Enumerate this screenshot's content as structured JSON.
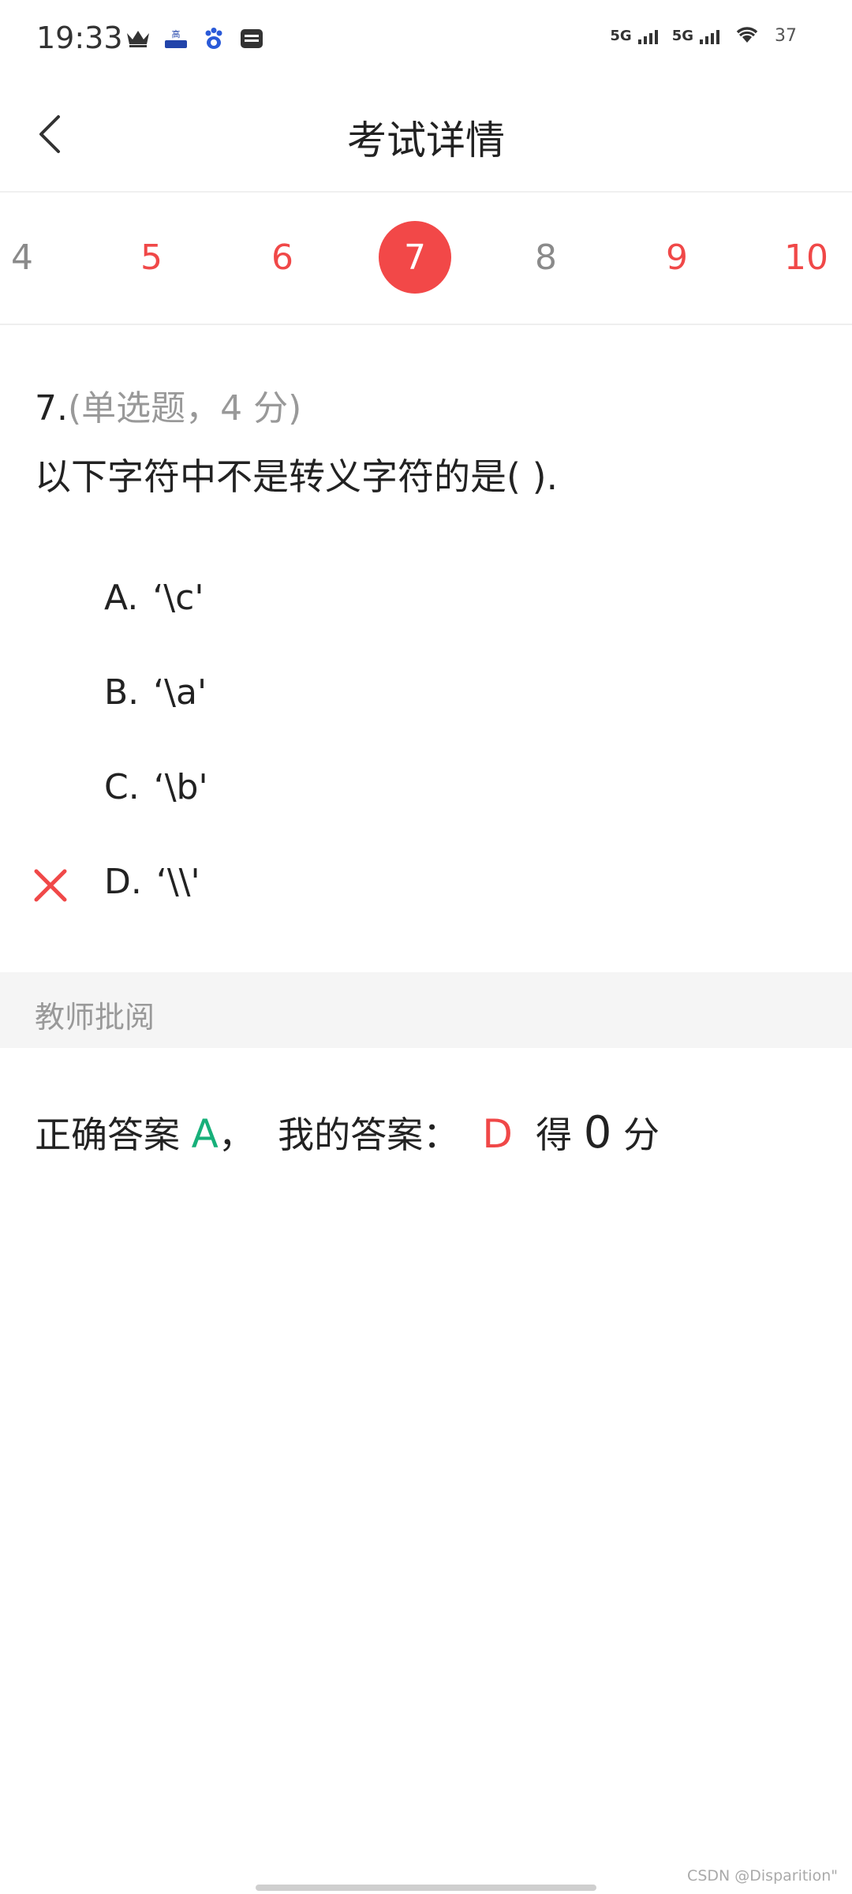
{
  "status_bar": {
    "time": "19:33",
    "left_icons": [
      "crown-icon",
      "gaotu-app-icon",
      "baidu-paw-icon",
      "message-box-icon"
    ],
    "sim1": "5G",
    "sim2": "5G",
    "battery": "37"
  },
  "header": {
    "title": "考试详情",
    "back_icon": "chevron-left-icon"
  },
  "question_nav": {
    "items": [
      {
        "label": "4",
        "state": "right"
      },
      {
        "label": "5",
        "state": "wrong"
      },
      {
        "label": "6",
        "state": "wrong"
      },
      {
        "label": "7",
        "state": "active"
      },
      {
        "label": "8",
        "state": "right"
      },
      {
        "label": "9",
        "state": "wrong"
      },
      {
        "label": "10",
        "state": "wrong"
      }
    ]
  },
  "question": {
    "number": "7.",
    "type_info": "(单选题，4 分)",
    "stem": "以下字符中不是转义字符的是( ).",
    "options": [
      {
        "letter": "A.",
        "text": "‘\\c'",
        "mark": ""
      },
      {
        "letter": "B.",
        "text": "‘\\a'",
        "mark": ""
      },
      {
        "letter": "C.",
        "text": "‘\\b'",
        "mark": ""
      },
      {
        "letter": "D.",
        "text": "‘\\\\'",
        "mark": "wrong-x-icon"
      }
    ]
  },
  "review": {
    "label": "教师批阅",
    "correct_prefix": "正确答案 ",
    "correct_answer": "A",
    "separator": "，  我的答案：  ",
    "my_answer": "D",
    "score_prefix": "  得 ",
    "score": "0",
    "score_suffix": " 分"
  },
  "colors": {
    "accent_red": "#f24848",
    "correct_green": "#17b07a",
    "muted_gray": "#999999"
  },
  "watermark": "CSDN @Disparition\""
}
